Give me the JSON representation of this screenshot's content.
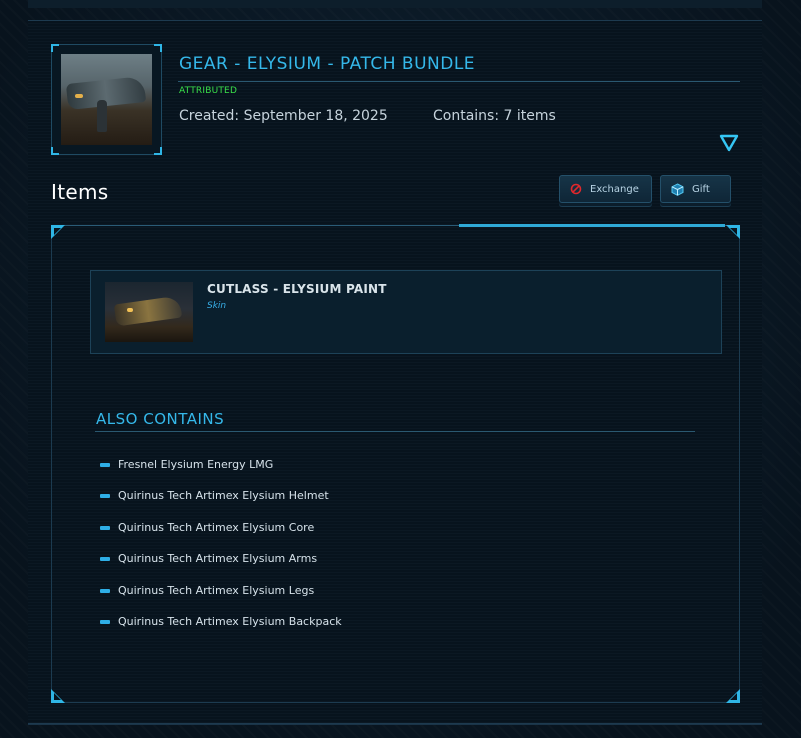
{
  "bundle": {
    "title": "GEAR - ELYSIUM - PATCH BUNDLE",
    "status": "ATTRIBUTED",
    "created": "Created: September 18, 2025",
    "contains": "Contains: 7 items"
  },
  "items_section": {
    "heading": "Items",
    "exchange_label": "Exchange",
    "gift_label": "Gift"
  },
  "item": {
    "name": "CUTLASS - ELYSIUM PAINT",
    "type": "Skin"
  },
  "also_contains": {
    "heading": "ALSO CONTAINS",
    "items": [
      "Fresnel Elysium Energy LMG",
      "Quirinus Tech Artimex Elysium Helmet",
      "Quirinus Tech Artimex Elysium Core",
      "Quirinus Tech Artimex Elysium Arms",
      "Quirinus Tech Artimex Elysium Legs",
      "Quirinus Tech Artimex Elysium Backpack"
    ]
  },
  "colors": {
    "accent": "#35b8ea",
    "attributed": "#39e04a",
    "background": "#07131d"
  },
  "icons": {
    "exchange": "forbidden-circle-icon",
    "gift": "gift-box-icon",
    "collapse": "triangle-down-icon"
  }
}
